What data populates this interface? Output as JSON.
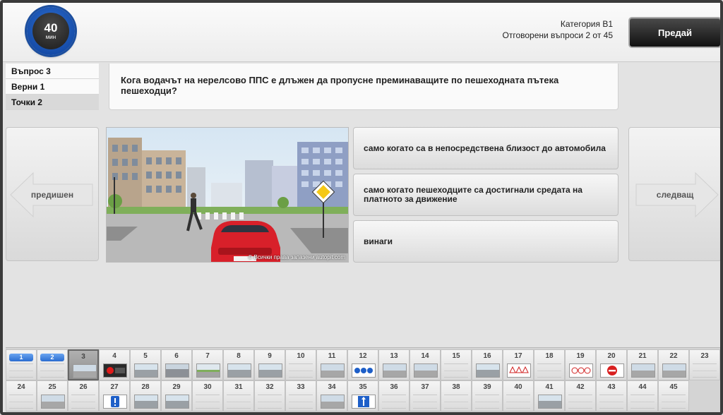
{
  "timer": {
    "value": "40",
    "unit": "мин"
  },
  "header": {
    "category": "Категория B1",
    "progress": "Отговорени въпроси 2 от 45",
    "submit_label": "Предай"
  },
  "info": {
    "question_label": "Въпрос 3",
    "correct_label": "Верни 1",
    "points_label": "Точки 2"
  },
  "question_text": "Кога водачът на нерелсово ППС е длъжен да пропусне преминаващите по пешеходната пътека пешеходци?",
  "picture": {
    "copyright": "© Всички права запазени autopit.com"
  },
  "answers": [
    "само когато са в непосредствена близост до автомобила",
    "само когато пешеходците са достигнали средата на платното за движение",
    "винаги"
  ],
  "nav": {
    "prev_label": "предишен",
    "next_label": "следващ"
  },
  "questions": [
    {
      "n": "1",
      "state": "answered",
      "icon": "none"
    },
    {
      "n": "2",
      "state": "answered",
      "icon": "none"
    },
    {
      "n": "3",
      "state": "current",
      "icon": "street-scene-icon"
    },
    {
      "n": "4",
      "state": "open",
      "icon": "traffic-light-icon"
    },
    {
      "n": "5",
      "state": "open",
      "icon": "road-car-icon"
    },
    {
      "n": "6",
      "state": "open",
      "icon": "intersection-icon"
    },
    {
      "n": "7",
      "state": "open",
      "icon": "road-icon"
    },
    {
      "n": "8",
      "state": "open",
      "icon": "road-car-icon"
    },
    {
      "n": "9",
      "state": "open",
      "icon": "road-car-icon"
    },
    {
      "n": "10",
      "state": "open",
      "icon": "none"
    },
    {
      "n": "11",
      "state": "open",
      "icon": "street-scene-icon"
    },
    {
      "n": "12",
      "state": "open",
      "icon": "blue-signs-icon"
    },
    {
      "n": "13",
      "state": "open",
      "icon": "street-scene-icon"
    },
    {
      "n": "14",
      "state": "open",
      "icon": "street-scene-icon"
    },
    {
      "n": "15",
      "state": "open",
      "icon": "none"
    },
    {
      "n": "16",
      "state": "open",
      "icon": "road-car-icon"
    },
    {
      "n": "17",
      "state": "open",
      "icon": "warning-signs-icon"
    },
    {
      "n": "18",
      "state": "open",
      "icon": "none"
    },
    {
      "n": "19",
      "state": "open",
      "icon": "prohibition-signs-icon"
    },
    {
      "n": "20",
      "state": "open",
      "icon": "no-entry-icon"
    },
    {
      "n": "21",
      "state": "open",
      "icon": "street-scene-icon"
    },
    {
      "n": "22",
      "state": "open",
      "icon": "street-scene-icon"
    },
    {
      "n": "23",
      "state": "open",
      "icon": "none"
    },
    {
      "n": "24",
      "state": "open",
      "icon": "none"
    },
    {
      "n": "25",
      "state": "open",
      "icon": "street-scene-icon"
    },
    {
      "n": "26",
      "state": "open",
      "icon": "none"
    },
    {
      "n": "27",
      "state": "open",
      "icon": "info-sign-icon"
    },
    {
      "n": "28",
      "state": "open",
      "icon": "road-car-icon"
    },
    {
      "n": "29",
      "state": "open",
      "icon": "road-car-icon"
    },
    {
      "n": "30",
      "state": "open",
      "icon": "none"
    },
    {
      "n": "31",
      "state": "open",
      "icon": "none"
    },
    {
      "n": "32",
      "state": "open",
      "icon": "none"
    },
    {
      "n": "33",
      "state": "open",
      "icon": "none"
    },
    {
      "n": "34",
      "state": "open",
      "icon": "street-scene-icon"
    },
    {
      "n": "35",
      "state": "open",
      "icon": "one-way-sign-icon"
    },
    {
      "n": "36",
      "state": "open",
      "icon": "none"
    },
    {
      "n": "37",
      "state": "open",
      "icon": "none"
    },
    {
      "n": "38",
      "state": "open",
      "icon": "none"
    },
    {
      "n": "39",
      "state": "open",
      "icon": "none"
    },
    {
      "n": "40",
      "state": "open",
      "icon": "none"
    },
    {
      "n": "41",
      "state": "open",
      "icon": "road-car-icon"
    },
    {
      "n": "42",
      "state": "open",
      "icon": "none"
    },
    {
      "n": "43",
      "state": "open",
      "icon": "none"
    },
    {
      "n": "44",
      "state": "open",
      "icon": "none"
    },
    {
      "n": "45",
      "state": "open",
      "icon": "none"
    }
  ],
  "colors": {
    "accent_blue": "#2a6cd0",
    "submit_dark": "#111111",
    "car_red": "#d8202a"
  }
}
